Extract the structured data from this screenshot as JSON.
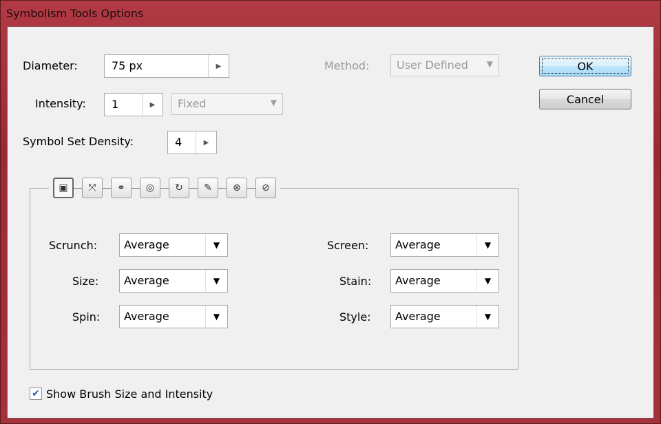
{
  "window": {
    "title": "Symbolism Tools Options"
  },
  "diameter": {
    "label": "Diameter:",
    "value": "75 px"
  },
  "method": {
    "label": "Method:",
    "value": "User Defined"
  },
  "intensity": {
    "label": "Intensity:",
    "value": "1",
    "mode": "Fixed"
  },
  "density": {
    "label": "Symbol Set Density:",
    "value": "4"
  },
  "buttons": {
    "ok": "OK",
    "cancel": "Cancel"
  },
  "tools": [
    {
      "name": "symbol-sprayer-icon",
      "glyph": "▣"
    },
    {
      "name": "symbol-shifter-icon",
      "glyph": "⤧"
    },
    {
      "name": "symbol-scruncher-icon",
      "glyph": "⚭"
    },
    {
      "name": "symbol-sizer-icon",
      "glyph": "◎"
    },
    {
      "name": "symbol-spinner-icon",
      "glyph": "↻"
    },
    {
      "name": "symbol-stainer-icon",
      "glyph": "✎"
    },
    {
      "name": "symbol-screener-icon",
      "glyph": "⊗"
    },
    {
      "name": "symbol-styler-icon",
      "glyph": "⊘"
    }
  ],
  "params": {
    "scrunch": {
      "label": "Scrunch:",
      "value": "Average"
    },
    "size": {
      "label": "Size:",
      "value": "Average"
    },
    "spin": {
      "label": "Spin:",
      "value": "Average"
    },
    "screen": {
      "label": "Screen:",
      "value": "Average"
    },
    "stain": {
      "label": "Stain:",
      "value": "Average"
    },
    "style": {
      "label": "Style:",
      "value": "Average"
    }
  },
  "show_brush": {
    "label": "Show Brush Size and Intensity",
    "checked": true
  }
}
